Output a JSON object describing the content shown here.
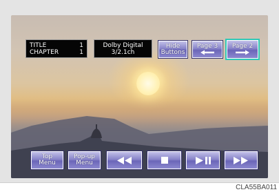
{
  "osd": {
    "title_label": "TITLE",
    "title_value": "1",
    "chapter_label": "CHAPTER",
    "chapter_value": "1",
    "audio_line1": "Dolby Digital",
    "audio_line2": "3/2.1ch"
  },
  "top_buttons": {
    "hide_line1": "Hide",
    "hide_line2": "Buttons",
    "page3_label": "Page 3",
    "page2_label": "Page 2"
  },
  "bottom_buttons": {
    "top_menu_line1": "Top",
    "top_menu_line2": "Menu",
    "popup_line1": "Pop-up",
    "popup_line2": "Menu"
  },
  "icons": {
    "page3_icon": "left-arrow-icon",
    "page2_icon": "right-arrow-icon",
    "rewind": "rewind-icon",
    "stop": "stop-icon",
    "play_pause": "play-pause-icon",
    "fast_forward": "fast-forward-icon"
  },
  "colors": {
    "button_face": "#8884c9",
    "selected_outline": "#2fc7b6",
    "osd_background": "#050505"
  },
  "figure_code": "CLA55BA011"
}
